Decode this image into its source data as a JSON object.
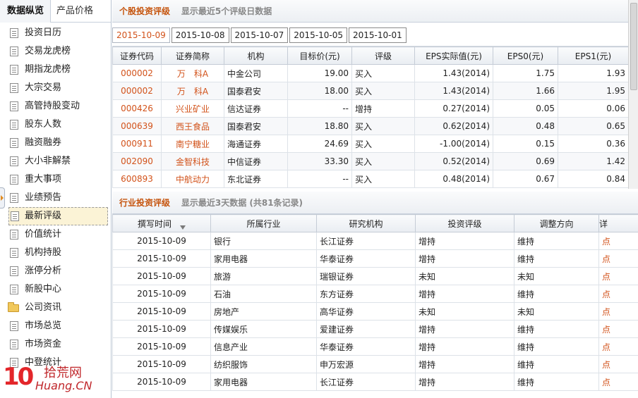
{
  "left_tabs": {
    "data_overview": "数据纵览",
    "product_price": "产品价格"
  },
  "nav": [
    {
      "label": "投资日历",
      "icon": "document-icon"
    },
    {
      "label": "交易龙虎榜",
      "icon": "document-icon"
    },
    {
      "label": "期指龙虎榜",
      "icon": "document-icon"
    },
    {
      "label": "大宗交易",
      "icon": "document-icon"
    },
    {
      "label": "高管持股变动",
      "icon": "document-icon"
    },
    {
      "label": "股东人数",
      "icon": "document-icon"
    },
    {
      "label": "融资融券",
      "icon": "document-icon"
    },
    {
      "label": "大小非解禁",
      "icon": "document-icon"
    },
    {
      "label": "重大事项",
      "icon": "document-icon"
    },
    {
      "label": "业绩预告",
      "icon": "document-icon"
    },
    {
      "label": "最新评级",
      "icon": "document-icon",
      "selected": true
    },
    {
      "label": "价值统计",
      "icon": "document-icon"
    },
    {
      "label": "机构持股",
      "icon": "document-icon"
    },
    {
      "label": "涨停分析",
      "icon": "document-icon"
    },
    {
      "label": "新股中心",
      "icon": "document-icon"
    },
    {
      "label": "公司资讯",
      "icon": "folder-icon"
    },
    {
      "label": "市场总览",
      "icon": "document-icon"
    },
    {
      "label": "市场资金",
      "icon": "document-icon"
    },
    {
      "label": "中登统计",
      "icon": "document-icon"
    }
  ],
  "watermark": {
    "num": "10",
    "cn": "拾荒网",
    "en": "Huang.CN"
  },
  "stock_section": {
    "title": "个股投资评级",
    "subtitle": "显示最近5个评级日数据",
    "date_tabs": [
      "2015-10-09",
      "2015-10-08",
      "2015-10-07",
      "2015-10-05",
      "2015-10-01"
    ],
    "active_tab": 0,
    "columns": [
      "证券代码",
      "证券简称",
      "机构",
      "目标价(元)",
      "评级",
      "EPS实际值(元)",
      "EPS0(元)",
      "EPS1(元)"
    ],
    "rows": [
      [
        "000002",
        "万　科A",
        "中金公司",
        "19.00",
        "买入",
        "1.43(2014)",
        "1.75",
        "1.93"
      ],
      [
        "000002",
        "万　科A",
        "国泰君安",
        "18.00",
        "买入",
        "1.43(2014)",
        "1.66",
        "1.95"
      ],
      [
        "000426",
        "兴业矿业",
        "信达证券",
        "--",
        "增持",
        "0.27(2014)",
        "0.05",
        "0.06"
      ],
      [
        "000639",
        "西王食品",
        "国泰君安",
        "18.80",
        "买入",
        "0.62(2014)",
        "0.48",
        "0.65"
      ],
      [
        "000911",
        "南宁糖业",
        "海通证券",
        "24.69",
        "买入",
        "-1.00(2014)",
        "0.15",
        "0.36"
      ],
      [
        "002090",
        "金智科技",
        "中信证券",
        "33.30",
        "买入",
        "0.52(2014)",
        "0.69",
        "1.42"
      ],
      [
        "600893",
        "中航动力",
        "东北证券",
        "--",
        "买入",
        "0.48(2014)",
        "0.67",
        "0.84"
      ]
    ]
  },
  "industry_section": {
    "title": "行业投资评级",
    "subtitle": "显示最近3天数据 (共81条记录)",
    "columns": [
      "撰写时间",
      "所属行业",
      "研究机构",
      "投资评级",
      "调整方向",
      "详"
    ],
    "link_text": "点",
    "rows": [
      [
        "2015-10-09",
        "银行",
        "长江证券",
        "增持",
        "维持"
      ],
      [
        "2015-10-09",
        "家用电器",
        "华泰证券",
        "增持",
        "维持"
      ],
      [
        "2015-10-09",
        "旅游",
        "瑞银证券",
        "未知",
        "未知"
      ],
      [
        "2015-10-09",
        "石油",
        "东方证券",
        "增持",
        "维持"
      ],
      [
        "2015-10-09",
        "房地产",
        "高华证券",
        "未知",
        "未知"
      ],
      [
        "2015-10-09",
        "传媒娱乐",
        "爱建证券",
        "增持",
        "维持"
      ],
      [
        "2015-10-09",
        "信息产业",
        "华泰证券",
        "增持",
        "维持"
      ],
      [
        "2015-10-09",
        "纺织服饰",
        "申万宏源",
        "增持",
        "维持"
      ],
      [
        "2015-10-09",
        "家用电器",
        "长江证券",
        "增持",
        "维持"
      ]
    ]
  }
}
